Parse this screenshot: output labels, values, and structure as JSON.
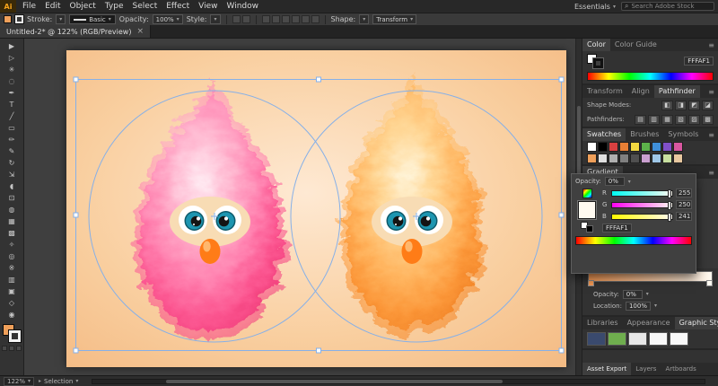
{
  "app": {
    "logo": "Ai",
    "menus": [
      "File",
      "Edit",
      "Object",
      "Type",
      "Select",
      "Effect",
      "View",
      "Window"
    ],
    "workspace": "Essentials",
    "search_placeholder": "Search Adobe Stock"
  },
  "control_bar": {
    "stroke_label": "Stroke:",
    "brush_value": "Basic",
    "opacity_label": "Opacity:",
    "opacity_value": "100%",
    "style_label": "Style:",
    "shape_label": "Shape:",
    "transform_label": "Transform"
  },
  "document_tab": {
    "title": "Untitled-2* @ 122% (RGB/Preview)",
    "close_glyph": "×"
  },
  "tools": [
    {
      "name": "selection",
      "glyph": "▶"
    },
    {
      "name": "direct-selection",
      "glyph": "▷"
    },
    {
      "name": "magic-wand",
      "glyph": "✳"
    },
    {
      "name": "lasso",
      "glyph": "◌"
    },
    {
      "name": "pen",
      "glyph": "✒"
    },
    {
      "name": "type",
      "glyph": "T"
    },
    {
      "name": "line-segment",
      "glyph": "╱"
    },
    {
      "name": "rectangle",
      "glyph": "▭"
    },
    {
      "name": "paintbrush",
      "glyph": "✏"
    },
    {
      "name": "pencil",
      "glyph": "✎"
    },
    {
      "name": "rotate",
      "glyph": "↻"
    },
    {
      "name": "scale",
      "glyph": "⇲"
    },
    {
      "name": "width",
      "glyph": "◖"
    },
    {
      "name": "free-transform",
      "glyph": "⊡"
    },
    {
      "name": "shape-builder",
      "glyph": "◍"
    },
    {
      "name": "mesh",
      "glyph": "▦"
    },
    {
      "name": "gradient",
      "glyph": "▩"
    },
    {
      "name": "eyedropper",
      "glyph": "✧"
    },
    {
      "name": "blend",
      "glyph": "◎"
    },
    {
      "name": "symbol-sprayer",
      "glyph": "※"
    },
    {
      "name": "column-graph",
      "glyph": "▥"
    },
    {
      "name": "artboard",
      "glyph": "▣"
    },
    {
      "name": "hand",
      "glyph": "◇"
    },
    {
      "name": "zoom",
      "glyph": "◉"
    }
  ],
  "tool_colors": {
    "fill": "#f0a05a"
  },
  "color_panel": {
    "tabs": [
      "Color",
      "Color Guide"
    ],
    "hex": "FFFAF1"
  },
  "pathfinder_panel": {
    "tabs": [
      "Transform",
      "Align",
      "Pathfinder"
    ],
    "shape_modes_label": "Shape Modes:",
    "pathfinders_label": "Pathfinders:",
    "shape_mode_glyphs": [
      "◧",
      "◨",
      "◩",
      "◪"
    ],
    "pathfinder_glyphs": [
      "▤",
      "▥",
      "▦",
      "▧",
      "▨",
      "▩"
    ]
  },
  "swatches_panel": {
    "tabs": [
      "Swatches",
      "Brushes",
      "Symbols"
    ],
    "row1": [
      "#ffffff",
      "#000000",
      "#d94040",
      "#e87f35",
      "#f2d840",
      "#5cb24a",
      "#3f8fd9",
      "#8050c8",
      "#d957a0"
    ],
    "row2": [
      "#f0a05a",
      "#e0e0e0",
      "#b0b0b0",
      "#808080",
      "#505050",
      "#caa0d0",
      "#a0c8e8",
      "#c8e0a0",
      "#e8c8a0"
    ]
  },
  "gradient_panel": {
    "tab": "Gradient",
    "opacity_label": "Opacity:",
    "opacity_value": "0%",
    "location_label": "Location:",
    "location_value": "100%",
    "stop_left": "#f59a55",
    "stop_right": "#fffaf1"
  },
  "color_editor": {
    "opacity_label": "Opacity:",
    "opacity_value": "0%",
    "channels": [
      {
        "label": "R",
        "value": "255"
      },
      {
        "label": "G",
        "value": "250"
      },
      {
        "label": "B",
        "value": "241"
      }
    ],
    "hex": "FFFAF1",
    "swatch": "#fffaf1"
  },
  "libraries_panel": {
    "tabs": [
      "Libraries",
      "Appearance",
      "Graphic Styles"
    ],
    "thumbs": [
      "#3a4a6e",
      "#6fae4e",
      "#e8e8e8",
      "#f8f8f8",
      "#f8f8f8"
    ]
  },
  "bottom_tabs": [
    "Asset Export",
    "Layers",
    "Artboards"
  ],
  "status_bar": {
    "zoom": "122%",
    "tool": "Selection"
  },
  "ui": {
    "selection_color": "#86b0e8",
    "accent": "#f0a05a"
  },
  "artboard": {
    "bg_c0": "#fee9d3",
    "bg_c1": "#f9cfa0",
    "bg_c2": "#f4bb84"
  },
  "pink": {
    "c0": "#ffe9f1",
    "c1": "#ffb6cf",
    "c2": "#ff7fae",
    "c3": "#fb548f",
    "c4": "#ef3a77"
  },
  "orange": {
    "c0": "#fff4d8",
    "c1": "#ffd694",
    "c2": "#ffb45e",
    "c3": "#fb9638",
    "c4": "#ef7f22"
  },
  "face": {
    "patch": "#f8dcb4",
    "white": "#ffffff",
    "iris": "#1d95b0",
    "iris_ring": "#0e5a6b",
    "pupil": "#141414",
    "glint": "#ffffff",
    "nose": "#ff7c17",
    "nose_highlight": "#ffc27d"
  }
}
